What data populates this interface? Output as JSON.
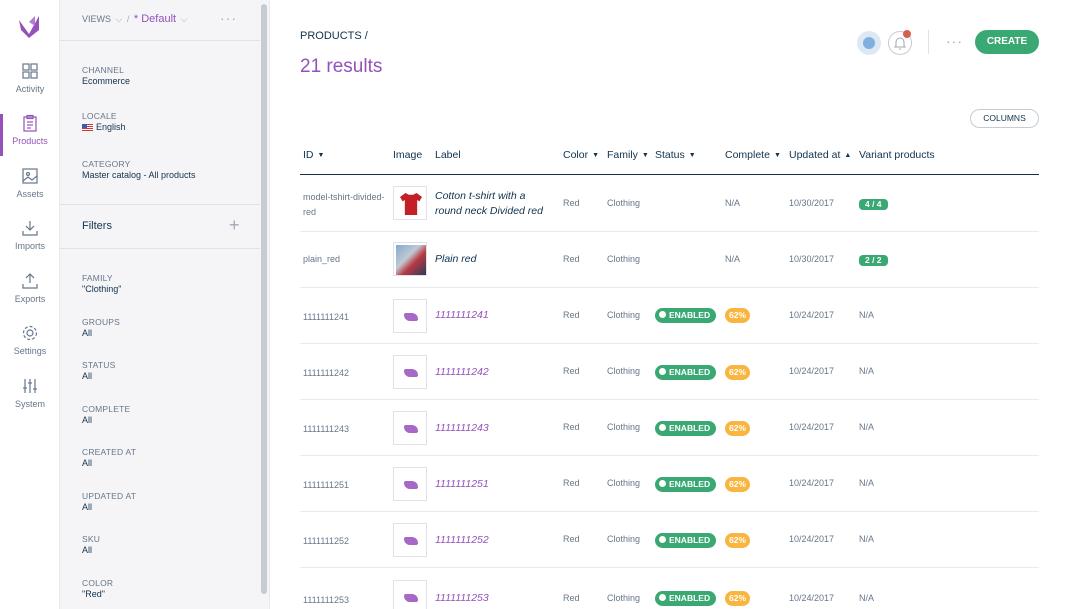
{
  "nav": {
    "items": [
      {
        "label": "Activity",
        "icon": "dashboard-icon"
      },
      {
        "label": "Products",
        "icon": "clipboard-icon"
      },
      {
        "label": "Assets",
        "icon": "image-icon"
      },
      {
        "label": "Imports",
        "icon": "import-icon"
      },
      {
        "label": "Exports",
        "icon": "export-icon"
      },
      {
        "label": "Settings",
        "icon": "gear-icon"
      },
      {
        "label": "System",
        "icon": "sliders-icon"
      }
    ],
    "active": "Products"
  },
  "panel": {
    "views_label": "Views",
    "views_value": "* Default",
    "channel": {
      "label": "Channel",
      "value": "Ecommerce"
    },
    "locale": {
      "label": "Locale",
      "value": "English"
    },
    "category": {
      "label": "Category",
      "value": "Master catalog - All products"
    },
    "filters_title": "Filters",
    "filters": [
      {
        "label": "Family",
        "value": "\"Clothing\""
      },
      {
        "label": "Groups",
        "value": "All"
      },
      {
        "label": "Status",
        "value": "All"
      },
      {
        "label": "Complete",
        "value": "All"
      },
      {
        "label": "Created at",
        "value": "All"
      },
      {
        "label": "Updated at",
        "value": "All"
      },
      {
        "label": "SKU",
        "value": "All"
      },
      {
        "label": "Color",
        "value": "\"Red\""
      }
    ]
  },
  "header": {
    "breadcrumb": "Products /",
    "results": "21 results",
    "create_label": "Create",
    "columns_label": "Columns"
  },
  "colors": {
    "accent": "#9452ba",
    "green": "#3aa873",
    "yellow": "#f9b53f",
    "text": "#11324d"
  },
  "grid": {
    "headers": {
      "id": "ID",
      "image": "Image",
      "label": "Label",
      "color": "Color",
      "family": "Family",
      "status": "Status",
      "complete": "Complete",
      "updated": "Updated at",
      "variant": "Variant products"
    },
    "rows": [
      {
        "id": "model-tshirt-divided-red",
        "label": "Cotton t-shirt with a round neck Divided red",
        "color": "Red",
        "family": "Clothing",
        "status": "",
        "complete": "N/A",
        "updated": "10/30/2017",
        "variant": "4 / 4"
      },
      {
        "id": "plain_red",
        "label": "Plain red",
        "color": "Red",
        "family": "Clothing",
        "status": "",
        "complete": "N/A",
        "updated": "10/30/2017",
        "variant": "2 / 2"
      },
      {
        "id": "1111111241",
        "label": "1111111241",
        "color": "Red",
        "family": "Clothing",
        "status": "Enabled",
        "complete": "62%",
        "updated": "10/24/2017",
        "variant": "N/A"
      },
      {
        "id": "1111111242",
        "label": "1111111242",
        "color": "Red",
        "family": "Clothing",
        "status": "Enabled",
        "complete": "62%",
        "updated": "10/24/2017",
        "variant": "N/A"
      },
      {
        "id": "1111111243",
        "label": "1111111243",
        "color": "Red",
        "family": "Clothing",
        "status": "Enabled",
        "complete": "62%",
        "updated": "10/24/2017",
        "variant": "N/A"
      },
      {
        "id": "1111111251",
        "label": "1111111251",
        "color": "Red",
        "family": "Clothing",
        "status": "Enabled",
        "complete": "62%",
        "updated": "10/24/2017",
        "variant": "N/A"
      },
      {
        "id": "1111111252",
        "label": "1111111252",
        "color": "Red",
        "family": "Clothing",
        "status": "Enabled",
        "complete": "62%",
        "updated": "10/24/2017",
        "variant": "N/A"
      },
      {
        "id": "1111111253",
        "label": "1111111253",
        "color": "Red",
        "family": "Clothing",
        "status": "Enabled",
        "complete": "62%",
        "updated": "10/24/2017",
        "variant": "N/A"
      }
    ]
  }
}
